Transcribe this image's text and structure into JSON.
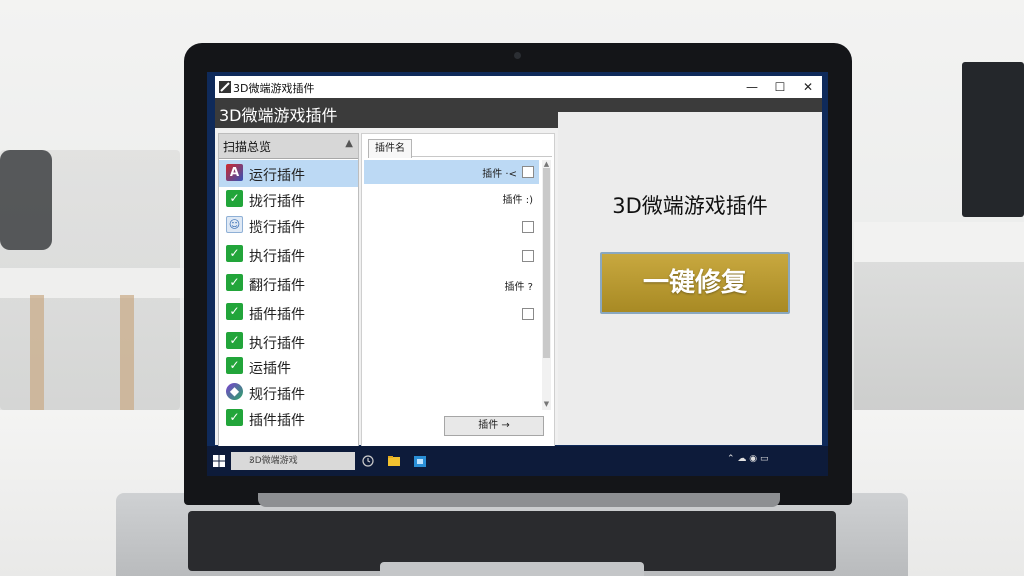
{
  "window": {
    "title": "3D微端游戏插件",
    "header": "3D微端游戏插件",
    "controls": {
      "minimize": "—",
      "maximize": "☐",
      "close": "✕"
    }
  },
  "left_panel": {
    "header": "扫描总览",
    "items": [
      {
        "label": "运行插件",
        "icon": "app-icon",
        "selected": true
      },
      {
        "label": "拢行插件",
        "icon": "check-icon"
      },
      {
        "label": "揽行插件",
        "icon": "user-icon"
      },
      {
        "label": "执行插件",
        "icon": "check-icon"
      },
      {
        "label": "翻行插件",
        "icon": "check-icon"
      },
      {
        "label": "插件插件",
        "icon": "check-icon"
      },
      {
        "label": "执行插件",
        "icon": "check-icon"
      },
      {
        "label": "运插件",
        "icon": "check-icon"
      },
      {
        "label": "规行插件",
        "icon": "gem-icon"
      },
      {
        "label": "插件插件",
        "icon": "check-icon"
      }
    ]
  },
  "middle_panel": {
    "tab": "插件名",
    "rows": [
      {
        "value": "插件 ·<",
        "checkbox": true,
        "selected": true
      },
      {
        "value": "插件 :)",
        "checkbox": false
      },
      {
        "value": "",
        "checkbox": true
      },
      {
        "value": "",
        "checkbox": true
      },
      {
        "value": "插件 ?",
        "checkbox": false
      },
      {
        "value": "",
        "checkbox": true
      }
    ],
    "button": "插件 →"
  },
  "right_panel": {
    "title": "3D微端游戏插件",
    "repair_button": "一键修复"
  },
  "taskbar": {
    "search_text": "3D微端游戏",
    "clock_line1": "",
    "clock_line2": ""
  },
  "colors": {
    "repair_button": "#b89a30",
    "selection": "#bcd9f4",
    "check": "#22a53a"
  }
}
